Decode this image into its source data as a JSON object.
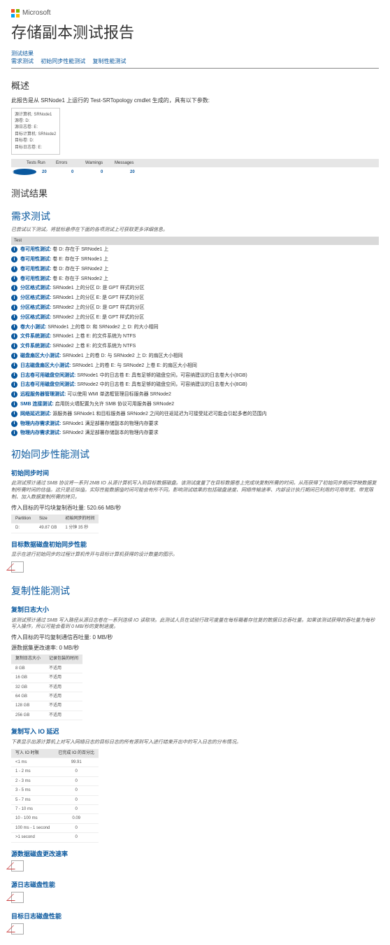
{
  "brand": "Microsoft",
  "title": "存储副本测试报告",
  "nav": [
    {
      "label": "测试结果"
    },
    {
      "label": "需求测试"
    },
    {
      "label": "初始同步性能测试"
    },
    {
      "label": "复制性能测试"
    }
  ],
  "overview": {
    "heading": "概述",
    "intro": "此报告是从 SRNode1 上运行的 Test-SRTopology cmdlet 生成的，具有以下参数:",
    "params": [
      "源计算机: SRNode1",
      "源卷: D:",
      "源日志卷: E:",
      "目标计算机: SRNode2",
      "目标卷: D:",
      "目标日志卷: E:"
    ],
    "summary_headers": [
      "Tests Run",
      "Errors",
      "Warnings",
      "Messages"
    ],
    "summary_values": [
      "20",
      "0",
      "0",
      "20"
    ]
  },
  "results": {
    "heading": "测试结果"
  },
  "req": {
    "heading": "需求测试",
    "note": "已尝试以下测试。将鼠标悬停在下面的各项测试上可获取更多详细信息。",
    "th": "Test",
    "rows": [
      {
        "t": "卷可用性测试",
        "d": "卷 D: 存在于 SRNode1 上"
      },
      {
        "t": "卷可用性测试",
        "d": "卷 E: 存在于 SRNode1 上"
      },
      {
        "t": "卷可用性测试",
        "d": "卷 D: 存在于 SRNode2 上"
      },
      {
        "t": "卷可用性测试",
        "d": "卷 E: 存在于 SRNode2 上"
      },
      {
        "t": "分区格式测试",
        "d": "SRNode1 上的分区 D: 是 GPT 样式的分区"
      },
      {
        "t": "分区格式测试",
        "d": "SRNode1 上的分区 E: 是 GPT 样式的分区"
      },
      {
        "t": "分区格式测试",
        "d": "SRNode2 上的分区 D: 是 GPT 样式的分区"
      },
      {
        "t": "分区格式测试",
        "d": "SRNode2 上的分区 E: 是 GPT 样式的分区"
      },
      {
        "t": "卷大小测试",
        "d": "SRNode1 上的卷 D: 和 SRNode2 上 D: 的大小相同"
      },
      {
        "t": "文件系统测试",
        "d": "SRNode1 上卷 E: 的文件系统为 NTFS"
      },
      {
        "t": "文件系统测试",
        "d": "SRNode2 上卷 E: 的文件系统为 NTFS"
      },
      {
        "t": "磁盘扇区大小测试",
        "d": "SRNode1 上的卷 D: 与 SRNode2 上 D: 的扇区大小相同"
      },
      {
        "t": "日志磁盘扇区大小测试",
        "d": "SRNode1 上的卷 E: 与 SRNode2 上卷 E: 的扇区大小相同"
      },
      {
        "t": "日志卷可用磁盘空间测试",
        "d": "SRNode1 中的日志卷 E: 具有足够的磁盘空间，可容纳建议的日志卷大小(8GB)"
      },
      {
        "t": "日志卷可用磁盘空间测试",
        "d": "SRNode2 中的日志卷 E: 具有足够的磁盘空间，可容纳建议的日志卷大小(8GB)"
      },
      {
        "t": "远程服务器管理测试",
        "d": "可以使用 WMI 单选框管理目标服务器 SRNode2"
      },
      {
        "t": "SMB 连接测试",
        "d": "启用防火墙配置为允许 SMB 协议可用服务器 SRNode2"
      },
      {
        "t": "网络延迟测试",
        "d": "源服务器 SRNode1 和目标服务器 SRNode2 之间的往返延迟为可接受延迟可能会引起多者的范围内"
      },
      {
        "t": "物理内存需求测试",
        "d": "SRNode1 满足部署存储副本的物理内存要求"
      },
      {
        "t": "物理内存需求测试",
        "d": "SRNode2 满足部署存储副本的物理内存要求"
      }
    ]
  },
  "init": {
    "heading": "初始同步性能测试",
    "sub1": "初始同步时间",
    "note1": "此测试预计通过 SMB 协议将一系列 2MB IO 从源计算机写入到目标数据磁盘。该测试度量了在目标数据卷上完成块复制所需的时间。从而获得了初始同步期间学映数据复制所需时间的估值。这只是近似值。实际性能数据值时间可能会有所不同。影响测试结果的包括磁盘速度、网络传输速率、内部设计执行期间已利用的可用带宽、带宽限制、加入数据复制所需的拷贝。",
    "line1": "传入目标的平均块复制吞吐量: 520.66 MB/秒",
    "tbl": {
      "headers": [
        "Partition",
        "Size",
        "初始同步的时间"
      ],
      "row": [
        "D:",
        "49.87 GB",
        "1 分钟 35 秒"
      ]
    },
    "sub2": "目标数据磁盘初始同步性能",
    "note2": "显示在进行初始同步的过程计算机传开与目标计算机获得的设计数量的图示。"
  },
  "repl": {
    "heading": "复制性能测试",
    "sub_logsize": "复制日志大小",
    "note_logsize": "该测试预计通过 SMB 写入路径从源日志卷在一系列连续 IO 读取块。此测试人员在试验行政可度量在每标箱着存往复的数据日志吞吐量。如果该测试获得的吞吐量为每秒写入操作，所以可能会看到 0 MB/秒的复制速度。",
    "line_logsize1": "传入目标的平均复制通信吞吐量: 0 MB/秒",
    "line_logsize2": "源数据集更改速率: 0 MB/秒",
    "tbl_logsize": {
      "headers": [
        "复制日志大小",
        "记录包装的时间"
      ],
      "rows": [
        [
          "8 GB",
          "不适用"
        ],
        [
          "16 GB",
          "不适用"
        ],
        [
          "32 GB",
          "不适用"
        ],
        [
          "64 GB",
          "不适用"
        ],
        [
          "128 GB",
          "不适用"
        ],
        [
          "256 GB",
          "不适用"
        ]
      ]
    },
    "sub_io": "复制写入 IO 延迟",
    "note_io": "下表显示出源计算机上对写入网络日志的目标日志的所有源到写入进行结束开出中的写入日志的分布情况。",
    "tbl_io": {
      "headers": [
        "写入 IO 时限",
        "已完成 IO 的百分比"
      ],
      "rows": [
        [
          "<1 ms",
          "99.91"
        ],
        [
          "1 - 2 ms",
          "0"
        ],
        [
          "2 - 3 ms",
          "0"
        ],
        [
          "3 - 5 ms",
          "0"
        ],
        [
          "5 - 7 ms",
          "0"
        ],
        [
          "7 - 10 ms",
          "0"
        ],
        [
          "10 - 100 ms",
          "0.09"
        ],
        [
          "100 ms - 1 second",
          "0"
        ],
        [
          ">1 second",
          "0"
        ]
      ]
    },
    "sub_change": "源数据磁盘更改速率",
    "sub_srclog": "源日志磁盘性能",
    "sub_dstlog": "目标日志磁盘性能"
  }
}
